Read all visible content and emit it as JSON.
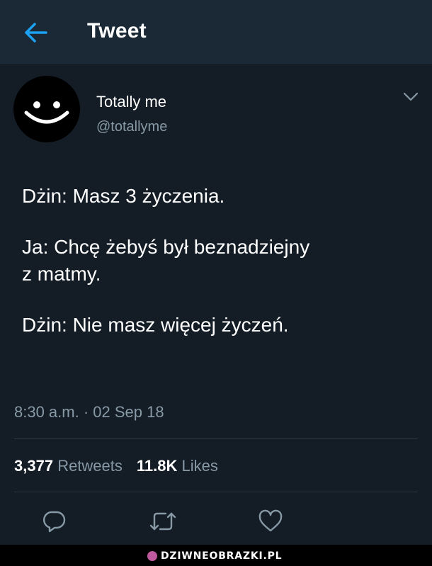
{
  "header": {
    "title": "Tweet",
    "back_icon": "arrow-left-icon",
    "accent_color": "#1da1f2"
  },
  "author": {
    "name": "Totally me",
    "handle": "@totallyme",
    "avatar": "smiley-face-avatar",
    "menu_icon": "chevron-down-icon"
  },
  "tweet": {
    "lines": [
      "Dżin: Masz 3 życzenia.",
      "Ja: Chcę żebyś był beznadziejny",
      "z matmy.",
      "Dżin: Nie masz więcej życzeń."
    ],
    "timestamp": "8:30 a.m. · 02 Sep 18"
  },
  "stats": {
    "retweets_count": "3,377",
    "retweets_label": "Retweets",
    "likes_count": "11.8K",
    "likes_label": "Likes"
  },
  "actions": {
    "reply_icon": "reply-icon",
    "retweet_icon": "retweet-icon",
    "like_icon": "heart-icon"
  },
  "watermark": {
    "text": "DZIWNEOBRAZKI.PL"
  },
  "colors": {
    "background": "#141d26",
    "header_background": "#1b2836",
    "secondary_text": "#8899a6",
    "divider": "#2b3945"
  }
}
